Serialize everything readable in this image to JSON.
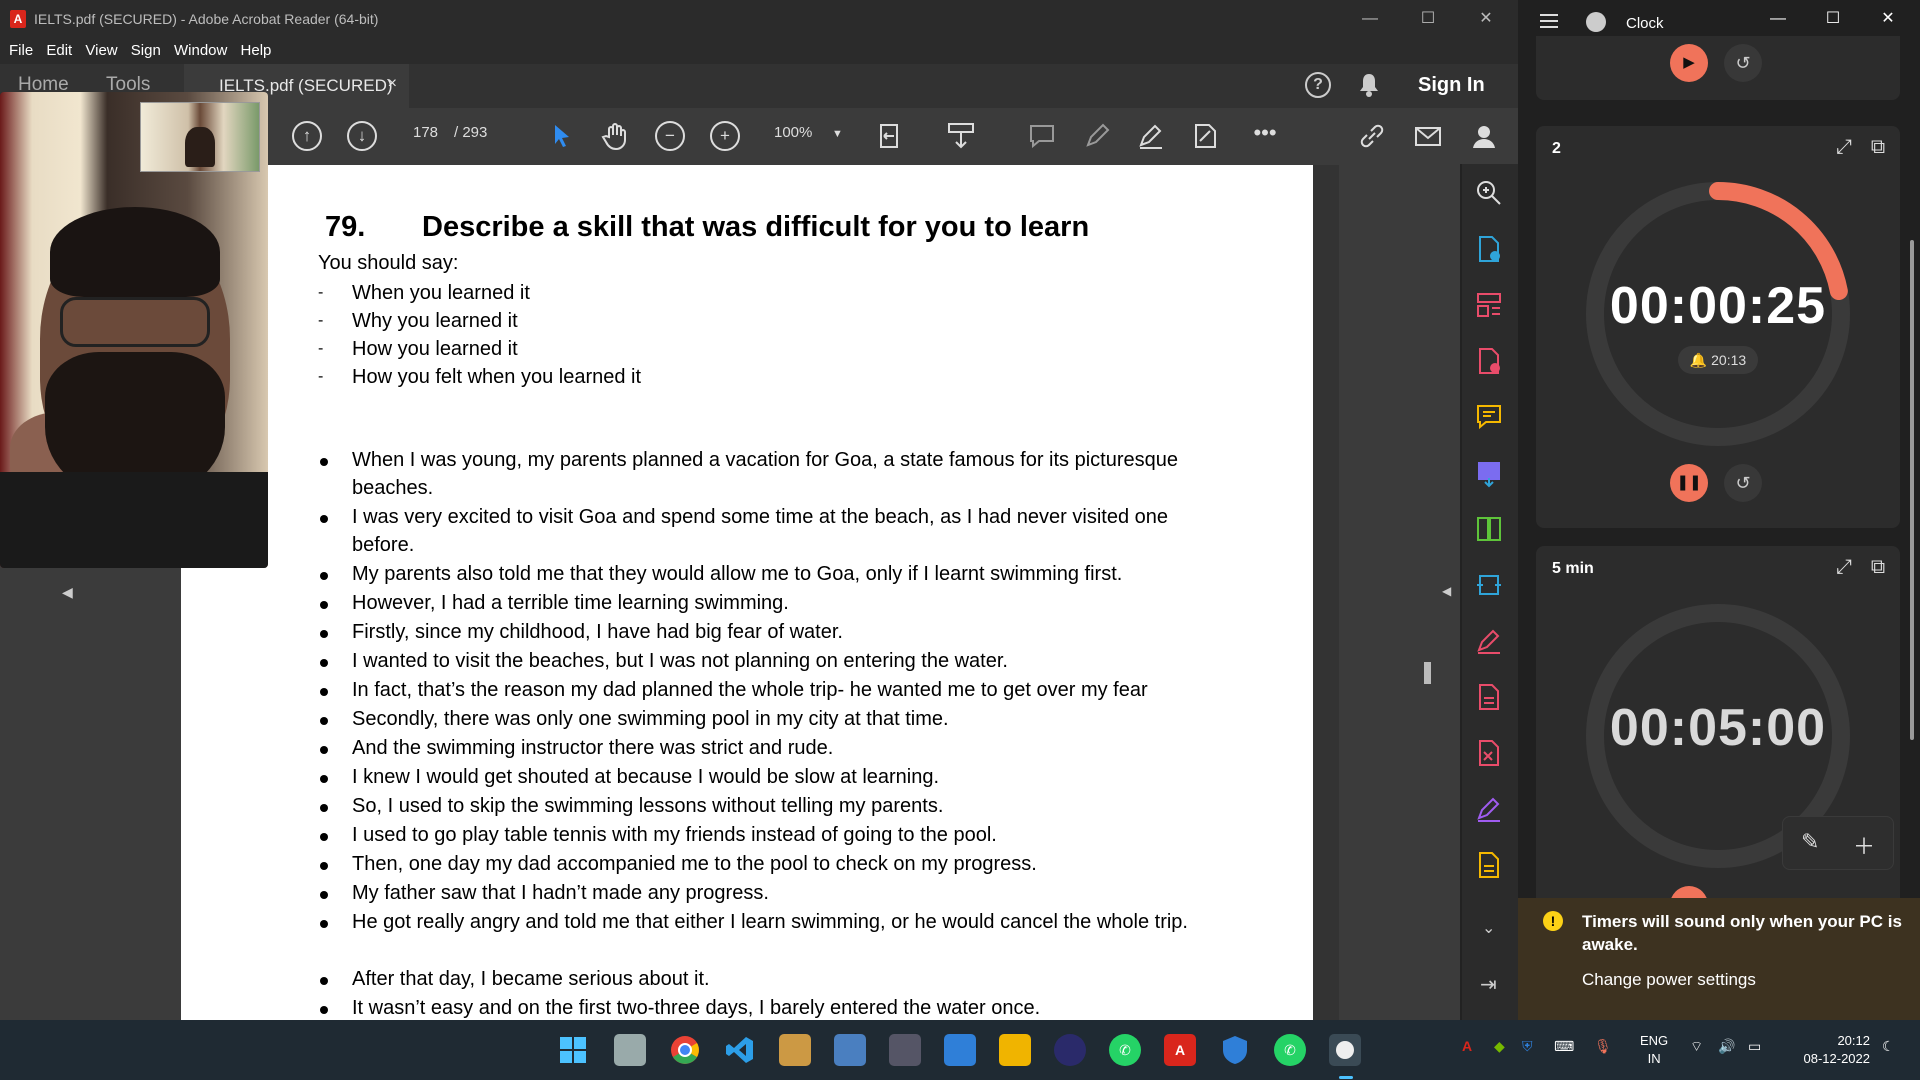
{
  "acrobat": {
    "window_title": "IELTS.pdf (SECURED) - Adobe Acrobat Reader (64-bit)",
    "menu": [
      "File",
      "Edit",
      "View",
      "Sign",
      "Window",
      "Help"
    ],
    "tabs": {
      "home": "Home",
      "tools": "Tools",
      "document": "IELTS.pdf (SECURED)",
      "close": "×"
    },
    "sign_in": "Sign In",
    "toolbar": {
      "page_current": "178",
      "page_total": "/ 293",
      "zoom": "100%"
    },
    "icons": [
      "prev-page-icon",
      "next-page-icon",
      "select-cursor-icon",
      "hand-icon",
      "zoom-out-icon",
      "zoom-in-icon",
      "zoom-dropdown-icon",
      "page-fit-icon",
      "scroll-mode-icon",
      "comment-icon",
      "highlight-icon",
      "sign-icon",
      "fill-sign-icon",
      "more-icon",
      "share-link-icon",
      "email-icon",
      "user-icon"
    ]
  },
  "document": {
    "number": "79.",
    "heading": "Describe a skill that was difficult for you to learn",
    "should_say": "You should say:",
    "prompts": [
      "When you learned it",
      "Why you learned it",
      "How you learned it",
      "How you felt when you learned it"
    ],
    "bullets": [
      "When I was young, my parents planned a vacation for Goa, a state famous for its picturesque beaches.",
      "I was very excited to visit Goa and spend some time at the beach, as I had never visited one before.",
      "My parents also told me that they would allow me to Goa, only if I learnt swimming first.",
      "However, I had a terrible time learning swimming.",
      "Firstly, since my childhood, I have had big fear of water.",
      "I wanted to visit the beaches, but I was not planning on entering the water.",
      "In fact, that’s the reason my dad planned the whole trip- he wanted me to get over my fear",
      "Secondly, there was only one swimming pool in my city at that time.",
      "And the swimming instructor there was strict and rude.",
      "I knew I would get shouted at because I would be slow at learning.",
      "So, I used to skip the swimming lessons without telling my parents.",
      "I used to go play table tennis with my friends instead of going to the pool.",
      "Then, one day my dad accompanied me to the pool to check on my progress.",
      "My father saw that I hadn’t made any progress.",
      "He got really angry and told me that either I learn swimming, or he would cancel the whole trip.",
      "After that day, I became serious about it.",
      "It wasn’t easy and on the first two-three days, I barely entered the water once."
    ]
  },
  "clock": {
    "title": "Clock",
    "timer1": {
      "name": "2",
      "time": "00:00:25",
      "alarm": "20:13",
      "progress": 0.22
    },
    "timer2": {
      "name": "5 min",
      "time": "00:05:00"
    },
    "toast": {
      "message": "Timers will sound only when your PC is awake.",
      "link": "Change power settings"
    }
  },
  "taskbar": {
    "language": "ENG",
    "region": "IN",
    "time": "20:12",
    "date": "08-12-2022"
  },
  "colors": {
    "accent": "#f0735a",
    "toast_bg": "#3d3220",
    "taskbar_bg": "#1f2a33"
  }
}
